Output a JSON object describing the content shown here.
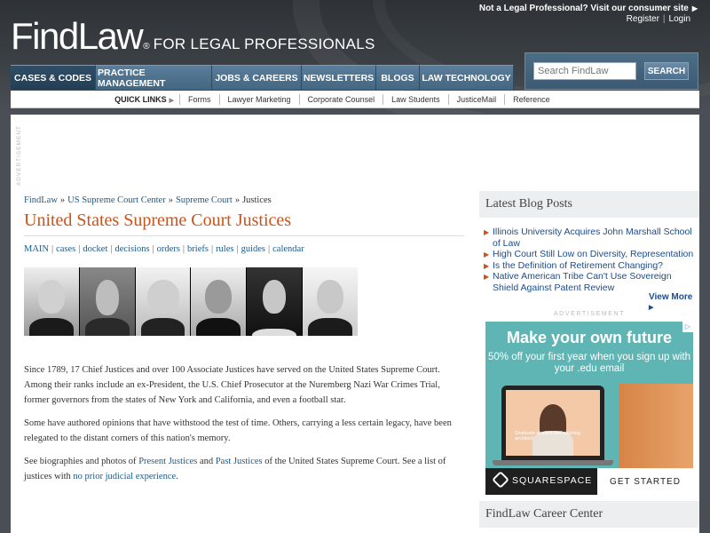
{
  "header": {
    "logo": "FindLaw",
    "logo_reg": "®",
    "tagline": "FOR LEGAL PROFESSIONALS",
    "consumer_link": "Not a Legal Professional? Visit our consumer site",
    "register": "Register",
    "login": "Login"
  },
  "nav": {
    "tabs": [
      {
        "label": "CASES & CODES",
        "active": true
      },
      {
        "label": "PRACTICE MANAGEMENT"
      },
      {
        "label": "JOBS & CAREERS"
      },
      {
        "label": "NEWSLETTERS"
      },
      {
        "label": "BLOGS"
      },
      {
        "label": "LAW TECHNOLOGY"
      }
    ],
    "search_placeholder": "Search FindLaw",
    "search_button": "SEARCH"
  },
  "quicklinks": {
    "label": "QUICK LINKS",
    "items": [
      "Forms",
      "Lawyer Marketing",
      "Corporate Counsel",
      "Law Students",
      "JusticeMail",
      "Reference"
    ]
  },
  "content": {
    "advert_vertical": "ADVERTISEMENT",
    "breadcrumbs": [
      "FindLaw",
      "US Supreme Court Center",
      "Supreme Court",
      "Justices"
    ],
    "breadcrumb_sep": "»",
    "title": "United States Supreme Court Justices",
    "subnav": [
      "MAIN",
      "cases",
      "docket",
      "decisions",
      "orders",
      "briefs",
      "rules",
      "guides",
      "calendar"
    ],
    "para1": "Since 1789, 17 Chief Justices and over 100 Associate Justices have served on the United States Supreme Court. Among their ranks include an ex-President, the U.S. Chief Prosecutor at the Nuremberg Nazi War Crimes Trial, former governors from the states of New York and California, and even a football star.",
    "para2": "Some have authored opinions that have withstood the test of time. Others, carrying a less certain legacy, have been relegated to the distant corners of this nation's memory.",
    "para3_a": "See biographies and photos of ",
    "para3_link1": "Present Justices",
    "para3_b": " and ",
    "para3_link2": "Past Justices",
    "para3_c": " of the United States Supreme Court. See a list of justices with ",
    "para3_link3": "no prior judicial experience",
    "para3_d": "."
  },
  "sidebar": {
    "blog_title": "Latest Blog Posts",
    "posts": [
      "Illinois University Acquires John Marshall School of Law",
      "High Court Still Low on Diversity, Representation",
      "Is the Definition of Retirement Changing?",
      "Native American Tribe Can't Use Sovereign Shield Against Patent Review"
    ],
    "view_more": "View More",
    "ad_label": "ADVERTISEMENT",
    "ad": {
      "headline": "Make your own future",
      "sub": "50% off your first year when you sign up with your .edu email",
      "screen_caption": "Graduate student and aspiring architect.",
      "brand": "SQUARESPACE",
      "cta": "GET STARTED"
    },
    "career_title": "FindLaw Career Center"
  }
}
